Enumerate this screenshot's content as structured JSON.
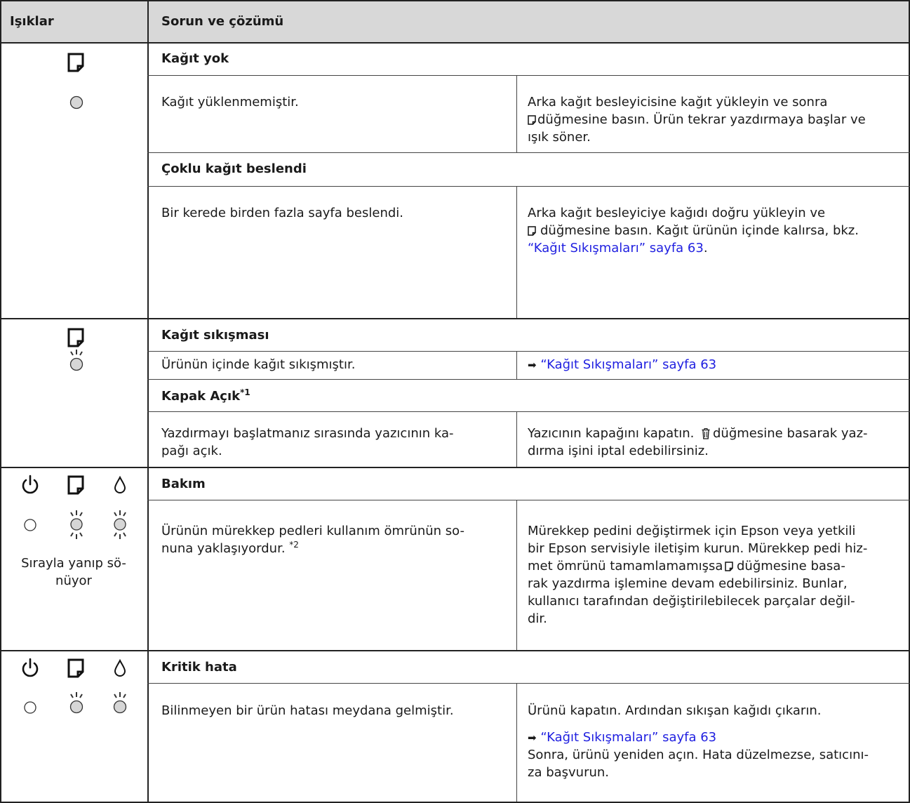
{
  "header": {
    "col_lights": "Işıklar",
    "col_problem": "Sorun ve çözümü"
  },
  "rows": {
    "paper_out": {
      "title": "Kağıt yok",
      "problem": "Kağıt yüklenmemiştir.",
      "solution_line1": "Arka kağıt besleyicisine kağıt yükleyin ve sonra",
      "solution_line2": "düğmesine basın. Ürün tekrar yazdırmaya başlar ve",
      "solution_line3": "ışık söner."
    },
    "multi_feed": {
      "title": "Çoklu kağıt beslendi",
      "problem": "Bir kerede birden fazla sayfa beslendi.",
      "solution_line1": "Arka kağıt besleyiciye kağıdı doğru yükleyin ve",
      "solution_line2": "düğmesine basın. Kağıt ürünün içinde kalırsa, bkz.",
      "solution_link": "“Kağıt Sıkışmaları” sayfa 63",
      "solution_link_suffix": "."
    },
    "paper_jam": {
      "title": "Kağıt sıkışması",
      "problem": "Ürünün içinde kağıt sıkışmıştır.",
      "solution_link": "“Kağıt Sıkışmaları” sayfa 63"
    },
    "cover_open": {
      "title": "Kapak Açık",
      "title_sup": "*1",
      "problem_line1": "Yazdırmayı başlatmanız sırasında yazıcının ka-",
      "problem_line2": "pağı açık.",
      "solution_line1": "Yazıcının kapağını kapatın.",
      "solution_line1b": "düğmesine basarak yaz-",
      "solution_line2": "dırma işini iptal edebilirsiniz."
    },
    "maintenance": {
      "title": "Bakım",
      "lights_caption_line1": "Sırayla yanıp sö-",
      "lights_caption_line2": "nüyor",
      "problem_line1": "Ürünün mürekkep pedleri kullanım ömrünün so-",
      "problem_line2": "nuna yaklaşıyordur.",
      "problem_sup": "*2",
      "solution_line1": "Mürekkep pedini değiştirmek için Epson veya yetkili",
      "solution_line2": "bir Epson servisiyle iletişim kurun. Mürekkep pedi hiz-",
      "solution_line3a": "met ömrünü tamamlamamışsa",
      "solution_line3b": "düğmesine basa-",
      "solution_line4": "rak yazdırma işlemine devam edebilirsiniz. Bunlar,",
      "solution_line5": "kullanıcı tarafından değiştirilebilecek parçalar değil-",
      "solution_line6": "dir."
    },
    "critical": {
      "title": "Kritik hata",
      "problem": "Bilinmeyen bir ürün hatası meydana gelmiştir.",
      "solution_line1": "Ürünü kapatın. Ardından sıkışan kağıdı çıkarın.",
      "solution_link": "“Kağıt Sıkışmaları” sayfa 63",
      "solution_line2": "Sonra, ürünü yeniden açın. Hata düzelmezse, satıcını-",
      "solution_line3": "za başvurun."
    }
  },
  "icons": {
    "arrow": "➡",
    "paper": "paper-icon",
    "power": "power-icon",
    "ink": "ink-drop-icon",
    "cancel": "trash-icon"
  },
  "colors": {
    "header_bg": "#d8d8d8",
    "link": "#1f1fe0",
    "led_fill": "#d6d6d6"
  }
}
